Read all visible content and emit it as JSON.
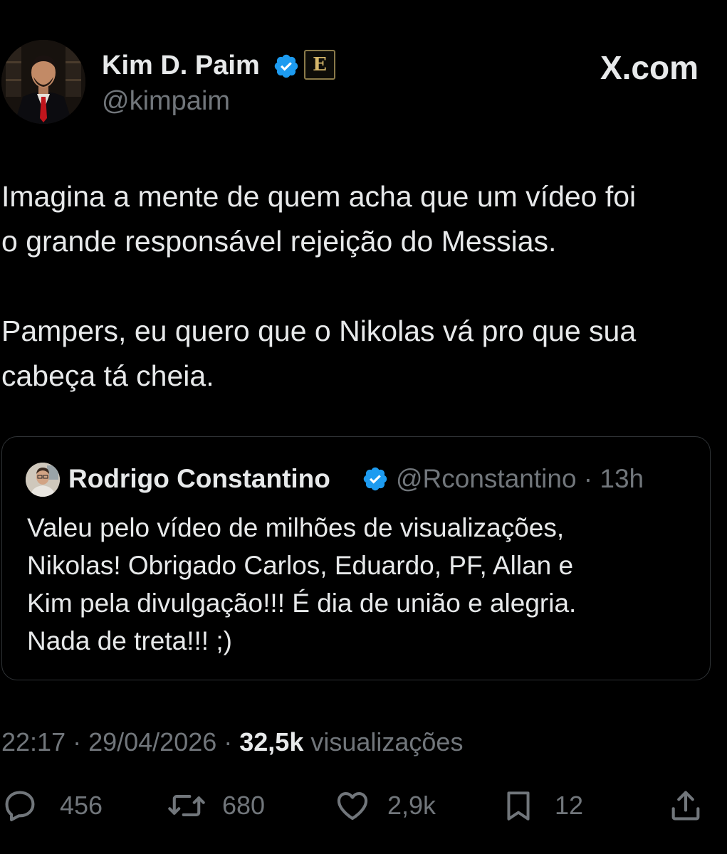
{
  "author": {
    "name": "Kim D. Paim",
    "handle": "@kimpaim",
    "affiliation_badge": "E",
    "verified": true
  },
  "site_label": "X.com",
  "tweet": {
    "paragraphs": [
      "Imagina a mente de quem acha que um vídeo foi\no grande responsável rejeição do Messias.",
      "Pampers, eu quero que o Nikolas vá pro que sua\ncabeça tá cheia."
    ]
  },
  "quoted": {
    "name": "Rodrigo Constantino",
    "meta": "@Rconstantino · 13h",
    "verified": true,
    "text": "Valeu pelo vídeo de milhões de visualizações,\nNikolas! Obrigado Carlos, Eduardo, PF, Allan e\nKim pela divulgação!!! É dia de união e alegria.\nNada de treta!!! ;)"
  },
  "meta": {
    "time_date": "22:17 · 29/04/2026 · ",
    "views_count": "32,5k",
    "views_label": " visualizações"
  },
  "actions": {
    "replies": "456",
    "reposts": "680",
    "likes": "2,9k",
    "bookmarks": "12"
  },
  "colors": {
    "background": "#000000",
    "text": "#e7e9ea",
    "muted": "#71767b",
    "verified": "#1d9bf0",
    "border": "#2f3336"
  },
  "icons": {
    "reply": "speech-bubble",
    "repost": "arrows-loop",
    "like": "heart-outline",
    "bookmark": "bookmark-outline",
    "share": "share-upload"
  }
}
